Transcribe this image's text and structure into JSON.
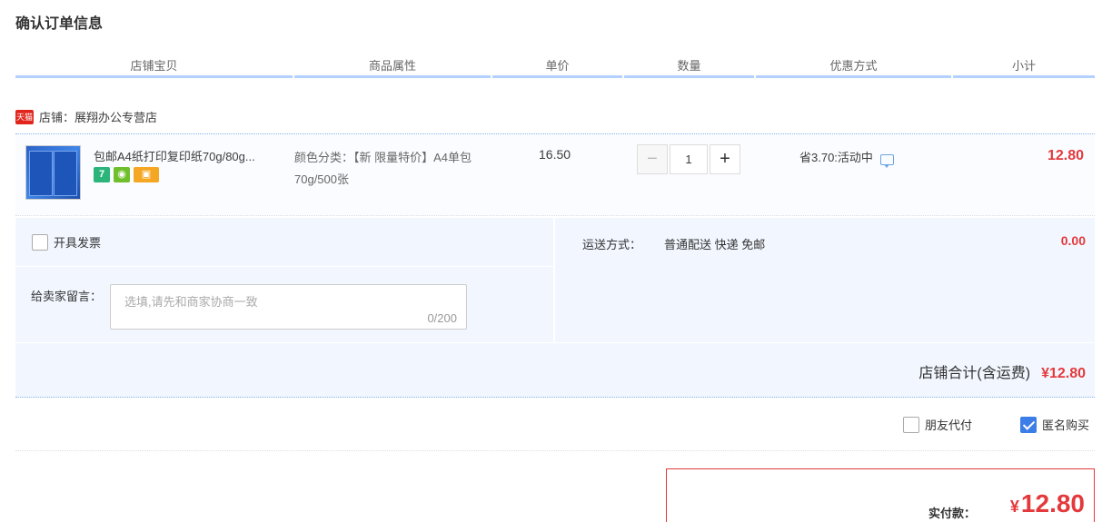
{
  "page": {
    "title": "确认订单信息"
  },
  "columns": [
    "店铺宝贝",
    "商品属性",
    "单价",
    "数量",
    "优惠方式",
    "小计"
  ],
  "shop": {
    "badge": "天猫",
    "label": "店铺：展翔办公专营店"
  },
  "item": {
    "title": "包邮A4纸打印复印纸70g/80g...",
    "service_icons": [
      "seven-day-return-icon",
      "guarantee-icon",
      "credit-card-icon"
    ],
    "service_seven": "7",
    "attr": "颜色分类：【新 限量特价】A4单包 70g/500张",
    "price": "16.50",
    "quantity": "1",
    "minus": "−",
    "plus": "+",
    "promo": "省3.70:活动中",
    "subtotal": "12.80"
  },
  "options": {
    "invoice_label": "开具发票",
    "message_label": "给卖家留言：",
    "message_placeholder": "选填,请先和商家协商一致",
    "message_count": "0/200",
    "shipping_label": "运送方式：",
    "shipping_value": "普通配送 快递 免邮",
    "shipping_fee": "0.00",
    "shop_total_label": "店铺合计(含运费)",
    "shop_total_value": "¥12.80"
  },
  "extras": {
    "friend_pay_label": "朋友代付",
    "friend_pay_checked": false,
    "anonymous_label": "匿名购买",
    "anonymous_checked": true
  },
  "payment": {
    "label": "实付款：",
    "currency": "¥",
    "value": "12.80"
  },
  "colors": {
    "accent_red": "#e4393c",
    "header_border": "#b2d1ff",
    "panel_bg": "#f2f7ff",
    "check_blue": "#3d7de8"
  }
}
